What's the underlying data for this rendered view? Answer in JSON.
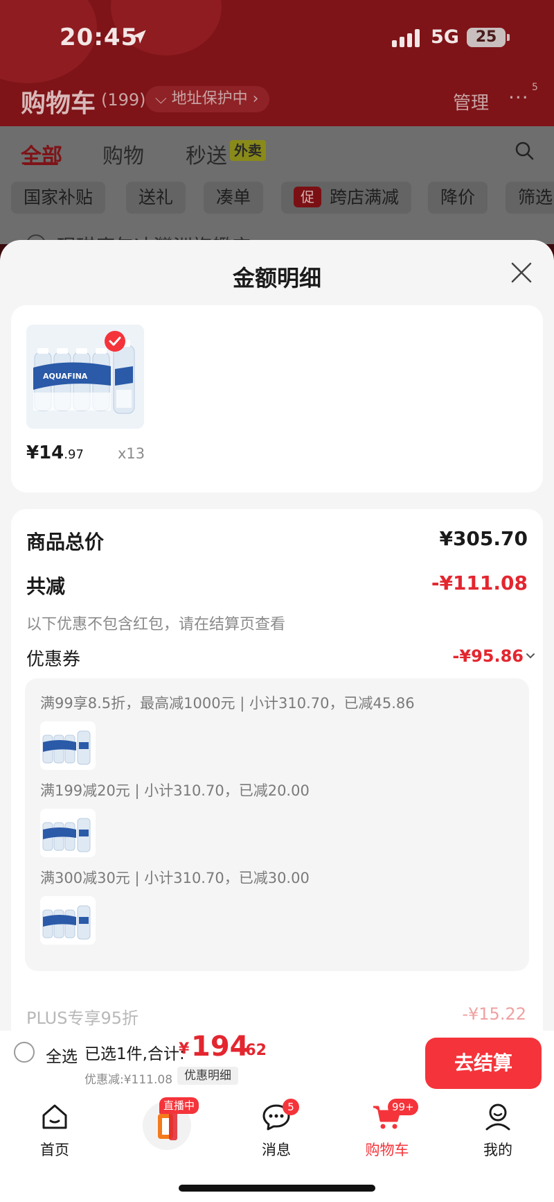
{
  "status": {
    "time": "20:45",
    "network": "5G",
    "battery": "25"
  },
  "header": {
    "title": "购物车",
    "count": "(199)",
    "address_pill": "地址保护中",
    "manage": "管理",
    "more_badge": "5"
  },
  "tabs": {
    "all": "全部",
    "shopping": "购物",
    "flash": "秒送",
    "flash_tag": "外卖"
  },
  "filters": {
    "chips": [
      "国家补贴",
      "送礼",
      "凑单",
      "跨店满减",
      "降价",
      "筛选"
    ],
    "promo_icon": "促"
  },
  "bg_row": {
    "text": "琨琪磨矢冰灣洲旗艦店"
  },
  "sheet": {
    "title": "金额明细",
    "item": {
      "brand": "AQUAFINA",
      "price_int": "¥14",
      "price_dec": ".97",
      "qty": "x13"
    },
    "total_label": "商品总价",
    "total_value": "¥305.70",
    "discount_label": "共减",
    "discount_value": "-¥111.08",
    "note": "以下优惠不包含红包，请在结算页查看",
    "coupon_label": "优惠券",
    "coupon_value": "-¥95.86",
    "rules": [
      "满99享8.5折，最高减1000元 | 小计310.70，已减45.86",
      "满199减20元 | 小计310.70，已减20.00",
      "满300减30元 | 小计310.70，已减30.00"
    ],
    "cut_label": "PLUS专享95折",
    "cut_value": "-¥15.22"
  },
  "checkout": {
    "select_all": "全选",
    "summary_label": "已选1件,合计:",
    "yen": "¥",
    "total_int": "194",
    "total_dec": ".62",
    "discount_text": "优惠减:¥111.08",
    "detail_button": "优惠明细",
    "checkout_button": "去结算"
  },
  "tabbar": {
    "home": "首页",
    "live_tag": "直播中",
    "messages": "消息",
    "messages_badge": "5",
    "cart": "购物车",
    "cart_badge": "99+",
    "mine": "我的"
  },
  "colors": {
    "accent": "#e3262f",
    "button": "#f4343a",
    "header_dim": "#7e1418"
  }
}
